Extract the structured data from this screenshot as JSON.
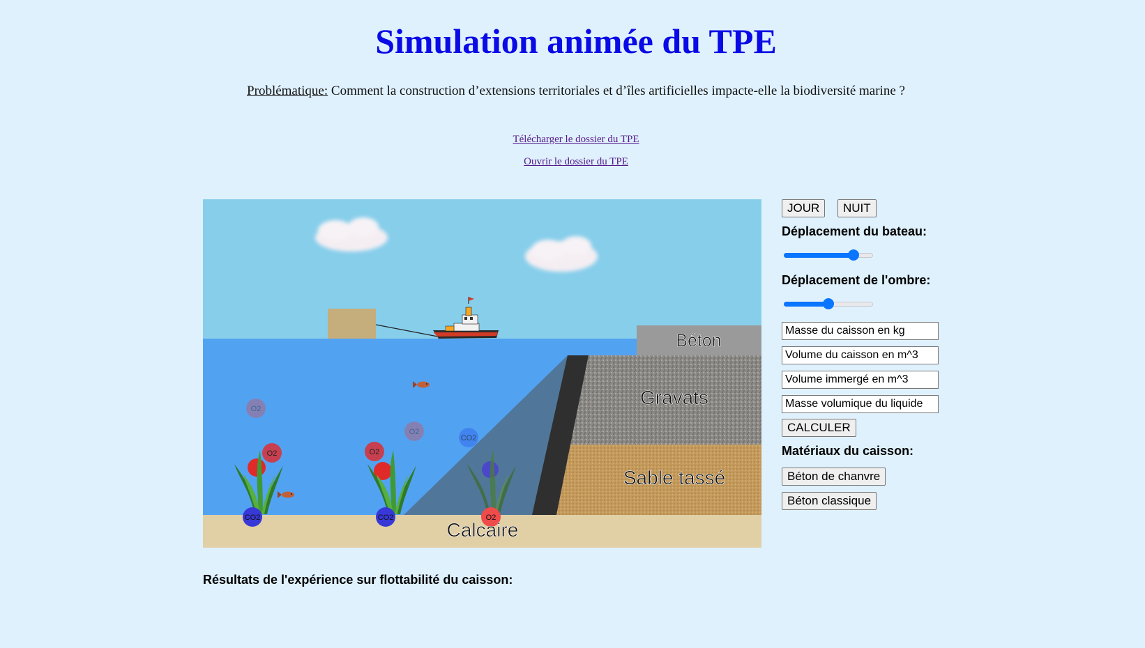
{
  "page": {
    "title": "Simulation animée du TPE",
    "problem_label": "Problématique:",
    "problem_text": " Comment la construction d’extensions territoriales et d’îles artificielles impacte-elle la biodiversité marine ?",
    "download_link": "Télécharger le dossier du TPE",
    "open_link": "Ouvrir le dossier du TPE"
  },
  "scene": {
    "layers": {
      "beton": "Béton",
      "gravats": "Gravats",
      "sable": "Sable tassé",
      "calcaire": "Calcaire"
    },
    "bubbles": {
      "o2": "O2",
      "co2": "CO2",
      "partial_o2": "2"
    }
  },
  "controls": {
    "day_button": "JOUR",
    "night_button": "NUIT",
    "boat_label": "Déplacement du bateau:",
    "boat_slider_value": 0.78,
    "shadow_label": "Déplacement de l'ombre:",
    "shadow_slider_value": 0.5,
    "mass_placeholder": "Masse du caisson en kg",
    "volume_placeholder": "Volume du caisson en m^3",
    "immersed_placeholder": "Volume immergé en m^3",
    "density_placeholder": "Masse volumique du liquide",
    "calc_button": "CALCULER",
    "materials_label": "Matériaux du caisson:",
    "hemp_button": "Béton de chanvre",
    "classic_button": "Béton classique"
  },
  "results": {
    "title": "Résultats de l'expérience sur flottabilité du caisson:"
  },
  "colors": {
    "title": "#0a0ae6",
    "sky": "#87ceeb",
    "water": "#52a2f2",
    "slider_accent": "#0a75ff"
  }
}
